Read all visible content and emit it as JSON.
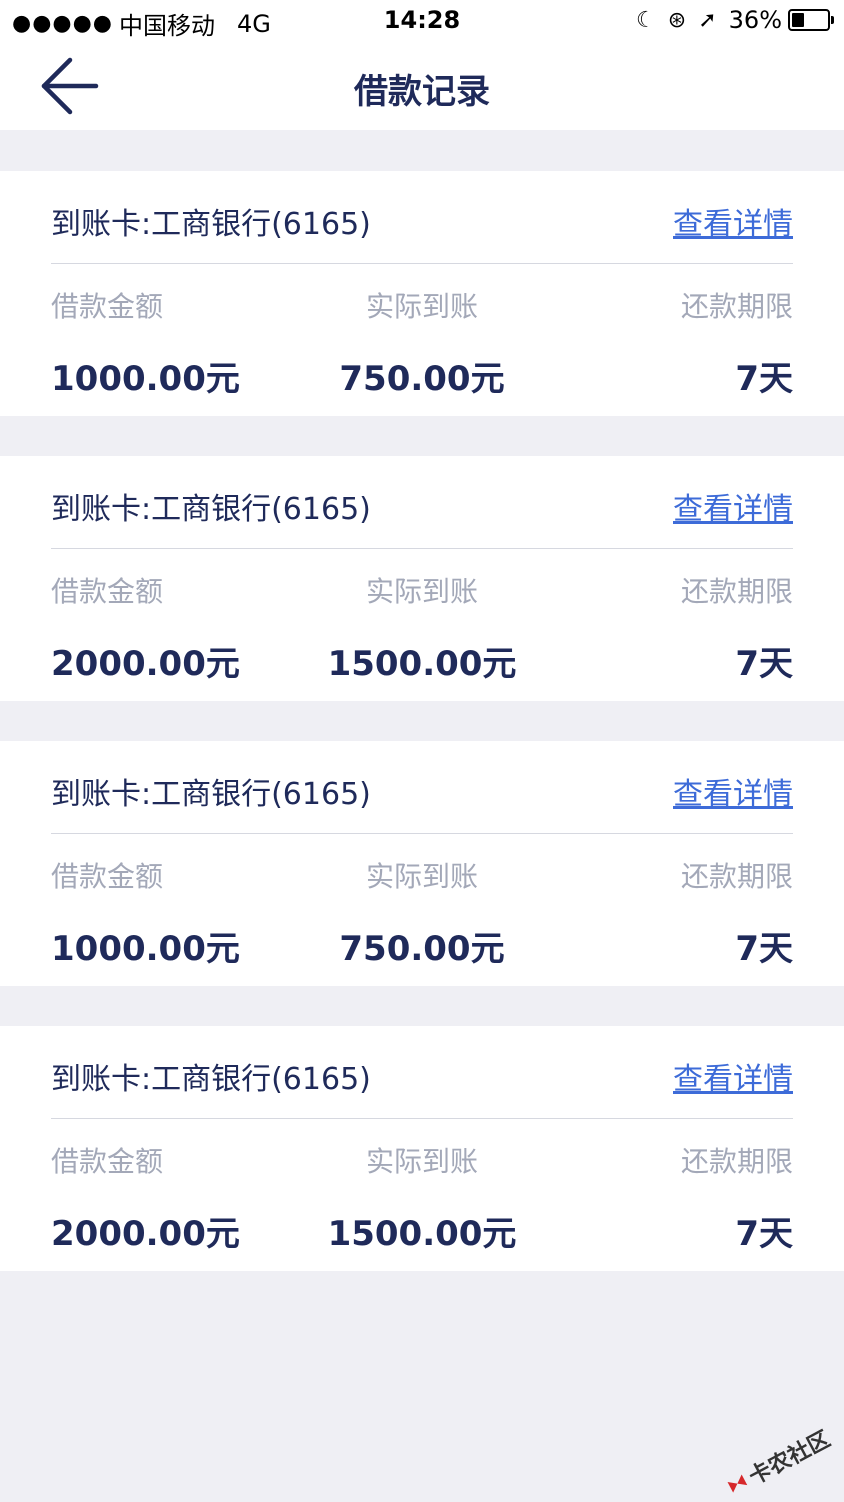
{
  "status_bar": {
    "signal_dots": "●●●●●",
    "carrier": "中国移动",
    "network": "4G",
    "time": "14:28",
    "moon_icon": "moon-icon",
    "rotation_lock_icon": "rotation-lock-icon",
    "location_icon": "location-arrow-icon",
    "battery": "36%",
    "battery_level": 0.36
  },
  "nav": {
    "back_icon": "back-arrow-icon",
    "title": "借款记录"
  },
  "records": [
    {
      "card": "到账卡:工商银行(6165)",
      "link": "查看详情",
      "amount_label": "借款金额",
      "amount": "1000.00元",
      "actual_label": "实际到账",
      "actual": "750.00元",
      "term_label": "还款期限",
      "term": "7天"
    },
    {
      "card": "到账卡:工商银行(6165)",
      "link": "查看详情",
      "amount_label": "借款金额",
      "amount": "2000.00元",
      "actual_label": "实际到账",
      "actual": "1500.00元",
      "term_label": "还款期限",
      "term": "7天"
    },
    {
      "card": "到账卡:工商银行(6165)",
      "link": "查看详情",
      "amount_label": "借款金额",
      "amount": "1000.00元",
      "actual_label": "实际到账",
      "actual": "750.00元",
      "term_label": "还款期限",
      "term": "7天"
    },
    {
      "card": "到账卡:工商银行(6165)",
      "link": "查看详情",
      "amount_label": "借款金额",
      "amount": "2000.00元",
      "actual_label": "实际到账",
      "actual": "1500.00元",
      "term_label": "还款期限",
      "term": "7天"
    }
  ],
  "watermark": "卡农社区",
  "colors": {
    "title": "#1f2a5a",
    "link": "#3d6bd8",
    "muted_label": "#a3a8b8",
    "background": "#efeff4"
  }
}
